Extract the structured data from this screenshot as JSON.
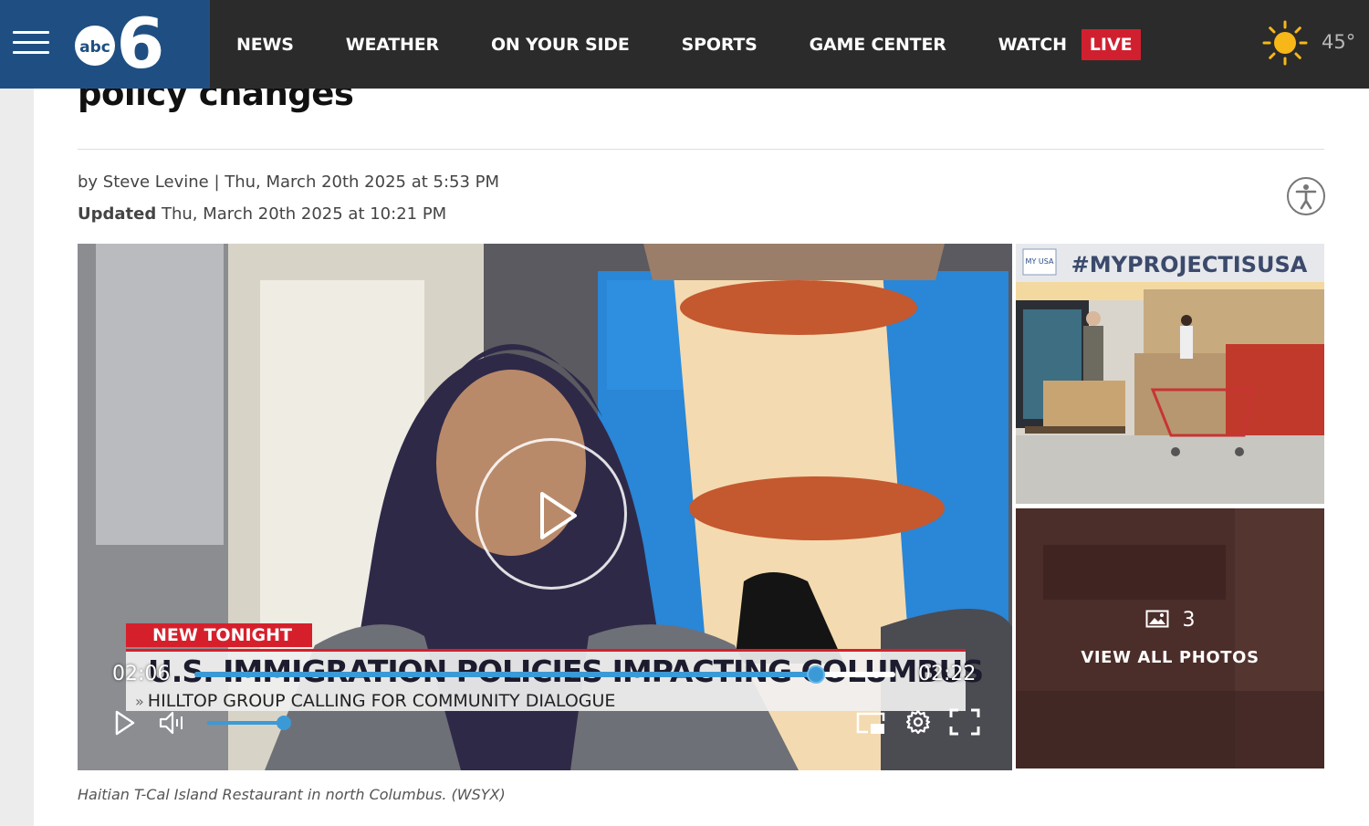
{
  "header": {
    "menu_icon": "hamburger-menu-icon",
    "logo": {
      "abc_text": "abc",
      "number_text": "6"
    },
    "nav_items": [
      {
        "label": "NEWS"
      },
      {
        "label": "WEATHER"
      },
      {
        "label": "ON YOUR SIDE"
      },
      {
        "label": "SPORTS"
      },
      {
        "label": "GAME CENTER"
      },
      {
        "label": "WATCH"
      }
    ],
    "live_badge": "LIVE",
    "weather": {
      "icon": "sun-icon",
      "temperature": "45°"
    },
    "colors": {
      "bar": "#2b2b2b",
      "brand": "#1f4f82",
      "live": "#d0202f"
    }
  },
  "article": {
    "headline": "policy changes",
    "byline": "by Steve Levine | Thu, March 20th 2025 at 5:53 PM",
    "updated_label": "Updated",
    "updated_value": " Thu, March 20th 2025 at 10:21 PM",
    "accessibility_icon": "accessibility-icon",
    "caption": "Haitian T-Cal Island Restaurant in north Columbus. (WSYX)"
  },
  "video": {
    "lower_third_tag": "NEW TONIGHT",
    "lower_third_headline": "U.S. IMMIGRATION POLICIES IMPACTING COLUMBUS",
    "lower_third_sub": "HILLTOP GROUP CALLING FOR COMMUNITY DIALOGUE",
    "lower_third_chevron": "»",
    "time_current": "02:06",
    "time_total": "02:22",
    "progress_fraction": 0.887,
    "volume_fraction": 0.95,
    "controls": [
      "play-icon",
      "volume-icon",
      "picture-in-picture-icon",
      "settings-gear-icon",
      "fullscreen-icon"
    ],
    "accent": "#3b9ad6"
  },
  "gallery": {
    "thumb1_banner": "#MYPROJECTISUSA",
    "thumb1_logo": "MY USA",
    "photo_count": "3",
    "photo_icon": "image-icon",
    "view_all_label": "VIEW ALL PHOTOS"
  }
}
